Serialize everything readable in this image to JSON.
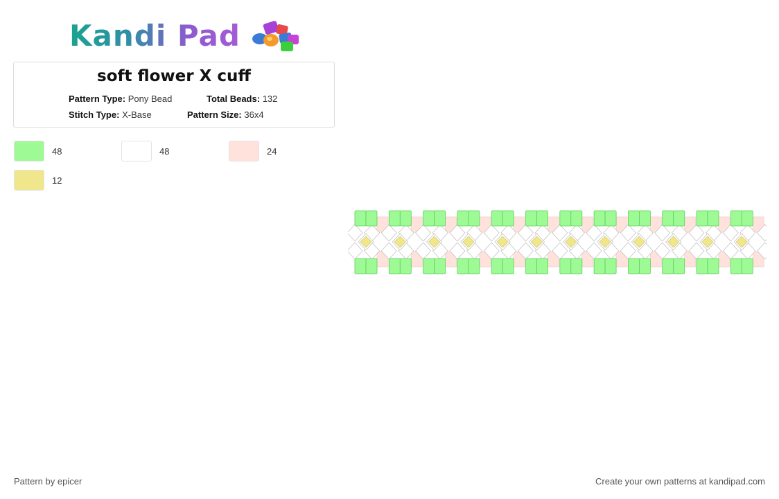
{
  "logo": {
    "text": "Kandi Pad",
    "colors": [
      "#1aa38f",
      "#8f5ad0"
    ],
    "icon": "bead-pile-icon"
  },
  "pattern_info": {
    "title": "soft flower X cuff",
    "pattern_type_label": "Pattern Type:",
    "pattern_type": "Pony Bead",
    "total_beads_label": "Total Beads:",
    "total_beads": "132",
    "stitch_type_label": "Stitch Type:",
    "stitch_type": "X-Base",
    "pattern_size_label": "Pattern Size:",
    "pattern_size": "36x4"
  },
  "palette": [
    {
      "color": "#9dfa94",
      "count": "48"
    },
    {
      "color": "#ffffff",
      "count": "48"
    },
    {
      "color": "#ffe2dc",
      "count": "24"
    },
    {
      "color": "#f0e68c",
      "count": "12"
    }
  ],
  "pattern": {
    "repeats": 12,
    "colors": {
      "green": "#9dfa94",
      "green_border": "#5fcf5a",
      "white": "#ffffff",
      "pink": "#ffe2dc",
      "yellow": "#f0e68c",
      "outline": "#bdbdbd"
    }
  },
  "footer": {
    "credit": "Pattern by epicer",
    "cta": "Create your own patterns at kandipad.com"
  }
}
